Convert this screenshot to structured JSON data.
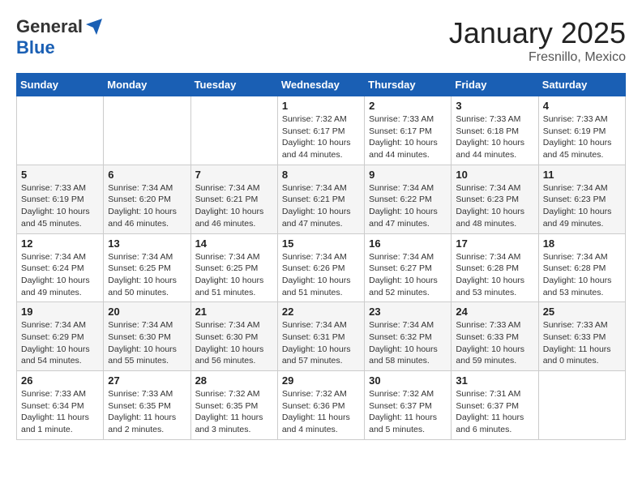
{
  "logo": {
    "general": "General",
    "blue": "Blue"
  },
  "title": {
    "month_year": "January 2025",
    "location": "Fresnillo, Mexico"
  },
  "days_of_week": [
    "Sunday",
    "Monday",
    "Tuesday",
    "Wednesday",
    "Thursday",
    "Friday",
    "Saturday"
  ],
  "weeks": [
    [
      {
        "day": "",
        "info": ""
      },
      {
        "day": "",
        "info": ""
      },
      {
        "day": "",
        "info": ""
      },
      {
        "day": "1",
        "info": "Sunrise: 7:32 AM\nSunset: 6:17 PM\nDaylight: 10 hours and 44 minutes."
      },
      {
        "day": "2",
        "info": "Sunrise: 7:33 AM\nSunset: 6:17 PM\nDaylight: 10 hours and 44 minutes."
      },
      {
        "day": "3",
        "info": "Sunrise: 7:33 AM\nSunset: 6:18 PM\nDaylight: 10 hours and 44 minutes."
      },
      {
        "day": "4",
        "info": "Sunrise: 7:33 AM\nSunset: 6:19 PM\nDaylight: 10 hours and 45 minutes."
      }
    ],
    [
      {
        "day": "5",
        "info": "Sunrise: 7:33 AM\nSunset: 6:19 PM\nDaylight: 10 hours and 45 minutes."
      },
      {
        "day": "6",
        "info": "Sunrise: 7:34 AM\nSunset: 6:20 PM\nDaylight: 10 hours and 46 minutes."
      },
      {
        "day": "7",
        "info": "Sunrise: 7:34 AM\nSunset: 6:21 PM\nDaylight: 10 hours and 46 minutes."
      },
      {
        "day": "8",
        "info": "Sunrise: 7:34 AM\nSunset: 6:21 PM\nDaylight: 10 hours and 47 minutes."
      },
      {
        "day": "9",
        "info": "Sunrise: 7:34 AM\nSunset: 6:22 PM\nDaylight: 10 hours and 47 minutes."
      },
      {
        "day": "10",
        "info": "Sunrise: 7:34 AM\nSunset: 6:23 PM\nDaylight: 10 hours and 48 minutes."
      },
      {
        "day": "11",
        "info": "Sunrise: 7:34 AM\nSunset: 6:23 PM\nDaylight: 10 hours and 49 minutes."
      }
    ],
    [
      {
        "day": "12",
        "info": "Sunrise: 7:34 AM\nSunset: 6:24 PM\nDaylight: 10 hours and 49 minutes."
      },
      {
        "day": "13",
        "info": "Sunrise: 7:34 AM\nSunset: 6:25 PM\nDaylight: 10 hours and 50 minutes."
      },
      {
        "day": "14",
        "info": "Sunrise: 7:34 AM\nSunset: 6:25 PM\nDaylight: 10 hours and 51 minutes."
      },
      {
        "day": "15",
        "info": "Sunrise: 7:34 AM\nSunset: 6:26 PM\nDaylight: 10 hours and 51 minutes."
      },
      {
        "day": "16",
        "info": "Sunrise: 7:34 AM\nSunset: 6:27 PM\nDaylight: 10 hours and 52 minutes."
      },
      {
        "day": "17",
        "info": "Sunrise: 7:34 AM\nSunset: 6:28 PM\nDaylight: 10 hours and 53 minutes."
      },
      {
        "day": "18",
        "info": "Sunrise: 7:34 AM\nSunset: 6:28 PM\nDaylight: 10 hours and 53 minutes."
      }
    ],
    [
      {
        "day": "19",
        "info": "Sunrise: 7:34 AM\nSunset: 6:29 PM\nDaylight: 10 hours and 54 minutes."
      },
      {
        "day": "20",
        "info": "Sunrise: 7:34 AM\nSunset: 6:30 PM\nDaylight: 10 hours and 55 minutes."
      },
      {
        "day": "21",
        "info": "Sunrise: 7:34 AM\nSunset: 6:30 PM\nDaylight: 10 hours and 56 minutes."
      },
      {
        "day": "22",
        "info": "Sunrise: 7:34 AM\nSunset: 6:31 PM\nDaylight: 10 hours and 57 minutes."
      },
      {
        "day": "23",
        "info": "Sunrise: 7:34 AM\nSunset: 6:32 PM\nDaylight: 10 hours and 58 minutes."
      },
      {
        "day": "24",
        "info": "Sunrise: 7:33 AM\nSunset: 6:33 PM\nDaylight: 10 hours and 59 minutes."
      },
      {
        "day": "25",
        "info": "Sunrise: 7:33 AM\nSunset: 6:33 PM\nDaylight: 11 hours and 0 minutes."
      }
    ],
    [
      {
        "day": "26",
        "info": "Sunrise: 7:33 AM\nSunset: 6:34 PM\nDaylight: 11 hours and 1 minute."
      },
      {
        "day": "27",
        "info": "Sunrise: 7:33 AM\nSunset: 6:35 PM\nDaylight: 11 hours and 2 minutes."
      },
      {
        "day": "28",
        "info": "Sunrise: 7:32 AM\nSunset: 6:35 PM\nDaylight: 11 hours and 3 minutes."
      },
      {
        "day": "29",
        "info": "Sunrise: 7:32 AM\nSunset: 6:36 PM\nDaylight: 11 hours and 4 minutes."
      },
      {
        "day": "30",
        "info": "Sunrise: 7:32 AM\nSunset: 6:37 PM\nDaylight: 11 hours and 5 minutes."
      },
      {
        "day": "31",
        "info": "Sunrise: 7:31 AM\nSunset: 6:37 PM\nDaylight: 11 hours and 6 minutes."
      },
      {
        "day": "",
        "info": ""
      }
    ]
  ]
}
